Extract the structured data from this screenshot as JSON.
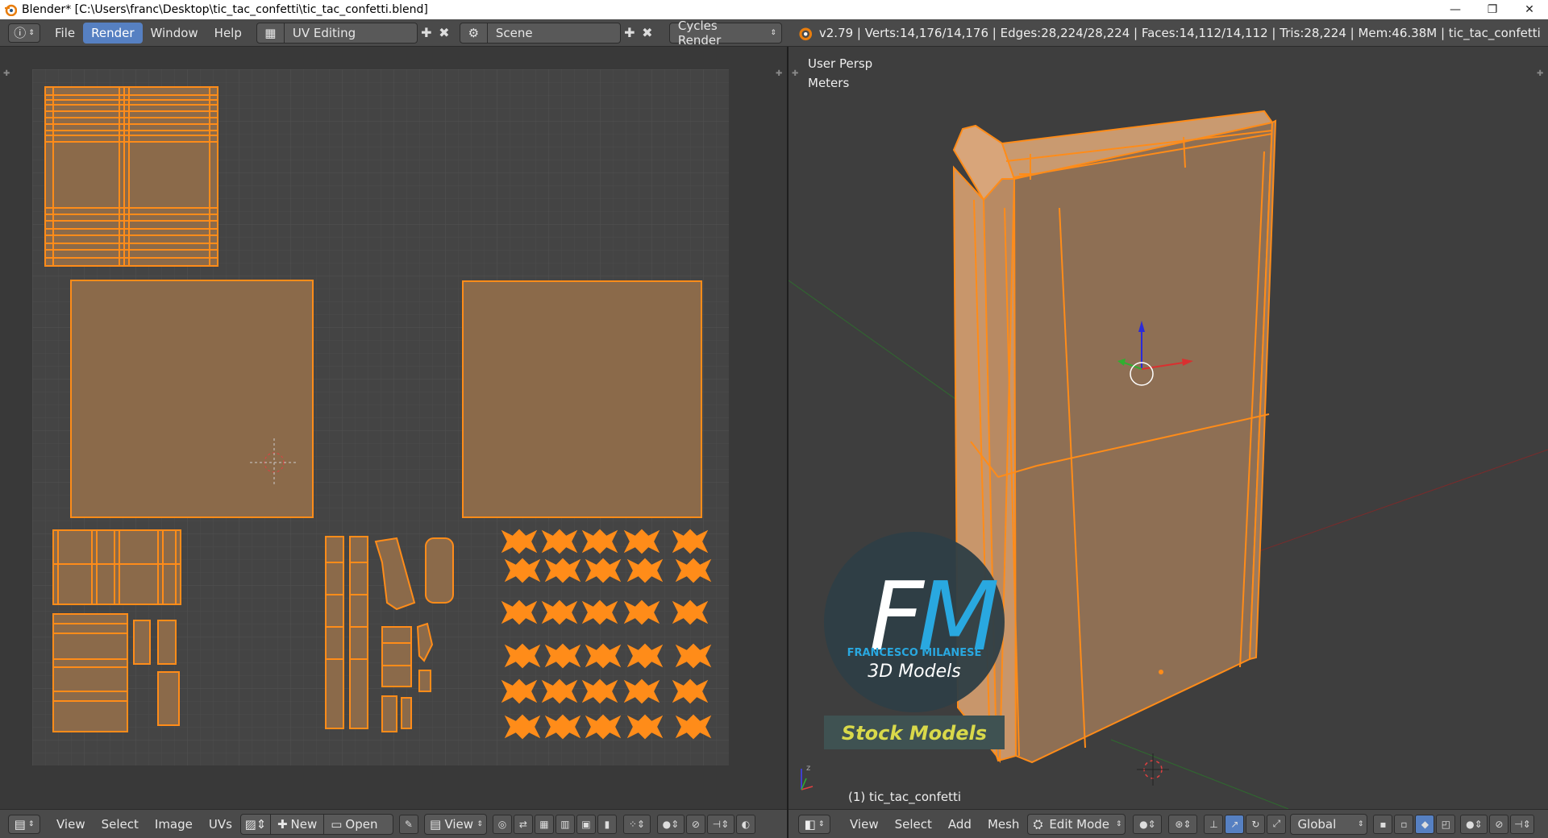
{
  "window": {
    "title": "Blender* [C:\\Users\\franc\\Desktop\\tic_tac_confetti\\tic_tac_confetti.blend]",
    "controls": [
      "—",
      "❐",
      "✕"
    ]
  },
  "topbar": {
    "menus": [
      "File",
      "Render",
      "Window",
      "Help"
    ],
    "active_menu": "Render",
    "screen_layout": "UV Editing",
    "scene": "Scene",
    "render_engine": "Cycles Render",
    "stats": "v2.79 | Verts:14,176/14,176 | Edges:28,224/28,224 | Faces:14,112/14,112 | Tris:28,224 | Mem:46.38M | tic_tac_confetti"
  },
  "viewport": {
    "view_name": "User Persp",
    "units": "Meters",
    "object_label": "(1) tic_tac_confetti"
  },
  "watermark": {
    "logo_letters": "FM",
    "brand": "FRANCESCO MILANESE",
    "sub": "3D Models",
    "banner": "Stock Models"
  },
  "uv_toolbar": {
    "items": [
      "View",
      "Select",
      "Image",
      "UVs"
    ],
    "new_label": "New",
    "open_label": "Open",
    "view_label": "View"
  },
  "view3d_toolbar": {
    "items": [
      "View",
      "Select",
      "Add",
      "Mesh"
    ],
    "mode": "Edit Mode",
    "orientation": "Global"
  },
  "colors": {
    "accent": "#5680c2",
    "selection": "#ff8c19",
    "face": "#8b6a4a"
  }
}
